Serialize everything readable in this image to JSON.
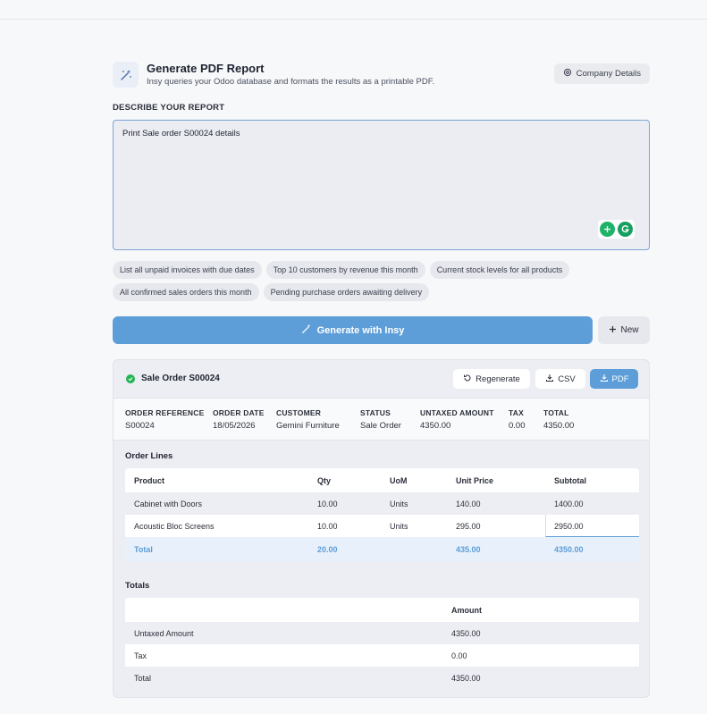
{
  "header": {
    "title": "Generate PDF Report",
    "subtitle": "Insy queries your Odoo database and formats the results as a printable PDF.",
    "company_button": "Company Details"
  },
  "prompt": {
    "label": "DESCRIBE YOUR REPORT",
    "value": "Print Sale order S00024 details"
  },
  "suggestions": {
    "row1": [
      "List all unpaid invoices with due dates",
      "Top 10 customers by revenue this month",
      "Current stock levels for all products"
    ],
    "row2": [
      "All confirmed sales orders this month",
      "Pending purchase orders awaiting delivery"
    ]
  },
  "actions": {
    "generate": "Generate with Insy",
    "new": "New"
  },
  "report": {
    "title": "Sale Order S00024",
    "regenerate": "Regenerate",
    "csv": "CSV",
    "pdf": "PDF",
    "summary": [
      {
        "key": "ORDER REFERENCE",
        "value": "S00024"
      },
      {
        "key": "ORDER DATE",
        "value": "18/05/2026"
      },
      {
        "key": "CUSTOMER",
        "value": "Gemini Furniture"
      },
      {
        "key": "STATUS",
        "value": "Sale Order"
      },
      {
        "key": "UNTAXED AMOUNT",
        "value": "4350.00"
      },
      {
        "key": "TAX",
        "value": "0.00"
      },
      {
        "key": "TOTAL",
        "value": "4350.00"
      }
    ],
    "order_lines": {
      "title": "Order Lines",
      "columns": [
        "Product",
        "Qty",
        "UoM",
        "Unit Price",
        "Subtotal"
      ],
      "rows": [
        [
          "Cabinet with Doors",
          "10.00",
          "Units",
          "140.00",
          "1400.00"
        ],
        [
          "Acoustic Bloc Screens",
          "10.00",
          "Units",
          "295.00",
          "2950.00"
        ]
      ],
      "total": [
        "Total",
        "20.00",
        "",
        "435.00",
        "4350.00"
      ]
    },
    "totals": {
      "title": "Totals",
      "columns": [
        "",
        "Amount"
      ],
      "rows": [
        [
          "Untaxed Amount",
          "4350.00"
        ],
        [
          "Tax",
          "0.00"
        ],
        [
          "Total",
          "4350.00"
        ]
      ]
    }
  }
}
